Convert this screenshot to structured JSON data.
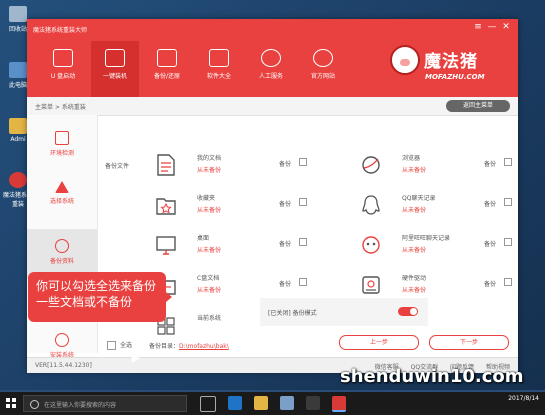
{
  "desktop": {
    "icons": [
      {
        "label": "回收站"
      },
      {
        "label": "此电脑"
      },
      {
        "label": "Admi"
      },
      {
        "label": "魔法猪系统重装"
      }
    ]
  },
  "window": {
    "title": "魔法猪系统重装大师",
    "controls": {
      "menu": "≡",
      "minimize": "—",
      "close": "✕"
    },
    "nav": [
      {
        "label": "U 盘启动",
        "active": false
      },
      {
        "label": "一键装机",
        "active": true
      },
      {
        "label": "备份/还原",
        "active": false
      },
      {
        "label": "软件大全",
        "active": false
      },
      {
        "label": "人工服务",
        "active": false
      },
      {
        "label": "官方网站",
        "active": false
      }
    ],
    "logo": {
      "cn": "魔法猪",
      "en": "MOFAZHU.COM"
    },
    "breadcrumb": "主菜单 > 系统重装",
    "back_button": "返回主菜单",
    "sidebar": [
      {
        "label": "环境检测",
        "active": false
      },
      {
        "label": "选择系统",
        "active": false
      },
      {
        "label": "备份资料",
        "active": true
      },
      {
        "label": "安装系统",
        "active": false
      }
    ],
    "section_label": "备份文件",
    "files_left": [
      {
        "name": "我的文档",
        "sub": "从未备份",
        "backup": "备份"
      },
      {
        "name": "收藏夹",
        "sub": "从未备份",
        "backup": "备份"
      },
      {
        "name": "桌面",
        "sub": "从未备份",
        "backup": "备份"
      },
      {
        "name": "C盘文档",
        "sub": "从未备份",
        "backup": "备份"
      },
      {
        "name": "当前系统",
        "sub": "",
        "backup": ""
      }
    ],
    "files_right": [
      {
        "name": "浏览器",
        "sub": "从未备份",
        "backup": "备份"
      },
      {
        "name": "QQ聊天记录",
        "sub": "从未备份",
        "backup": "备份"
      },
      {
        "name": "阿里旺旺聊天记录",
        "sub": "从未备份",
        "backup": "备份"
      },
      {
        "name": "硬件驱动",
        "sub": "从未备份",
        "backup": "备份"
      }
    ],
    "advanced": {
      "label": "[已关闭] 备份模式"
    },
    "select_all": "全选",
    "backup_dir_label": "备份目录：",
    "backup_dir_value": "D:\\mofazhu\\bak\\",
    "prev_button": "上一步",
    "next_button": "下一步",
    "version": "VER[11.5.44.1230]",
    "footer_links": [
      "微信客服",
      "QQ交流群",
      "问题反馈",
      "帮助视频"
    ]
  },
  "tooltip": {
    "text": "你可以勾选全选来备份一些文档或不备份"
  },
  "taskbar": {
    "search_placeholder": "在这里输入你要搜索的内容",
    "time": "",
    "date": "2017/8/14"
  },
  "watermark": "shenduwin10.com",
  "colors": {
    "accent": "#e9413f",
    "accent_dark": "#d5302e"
  }
}
